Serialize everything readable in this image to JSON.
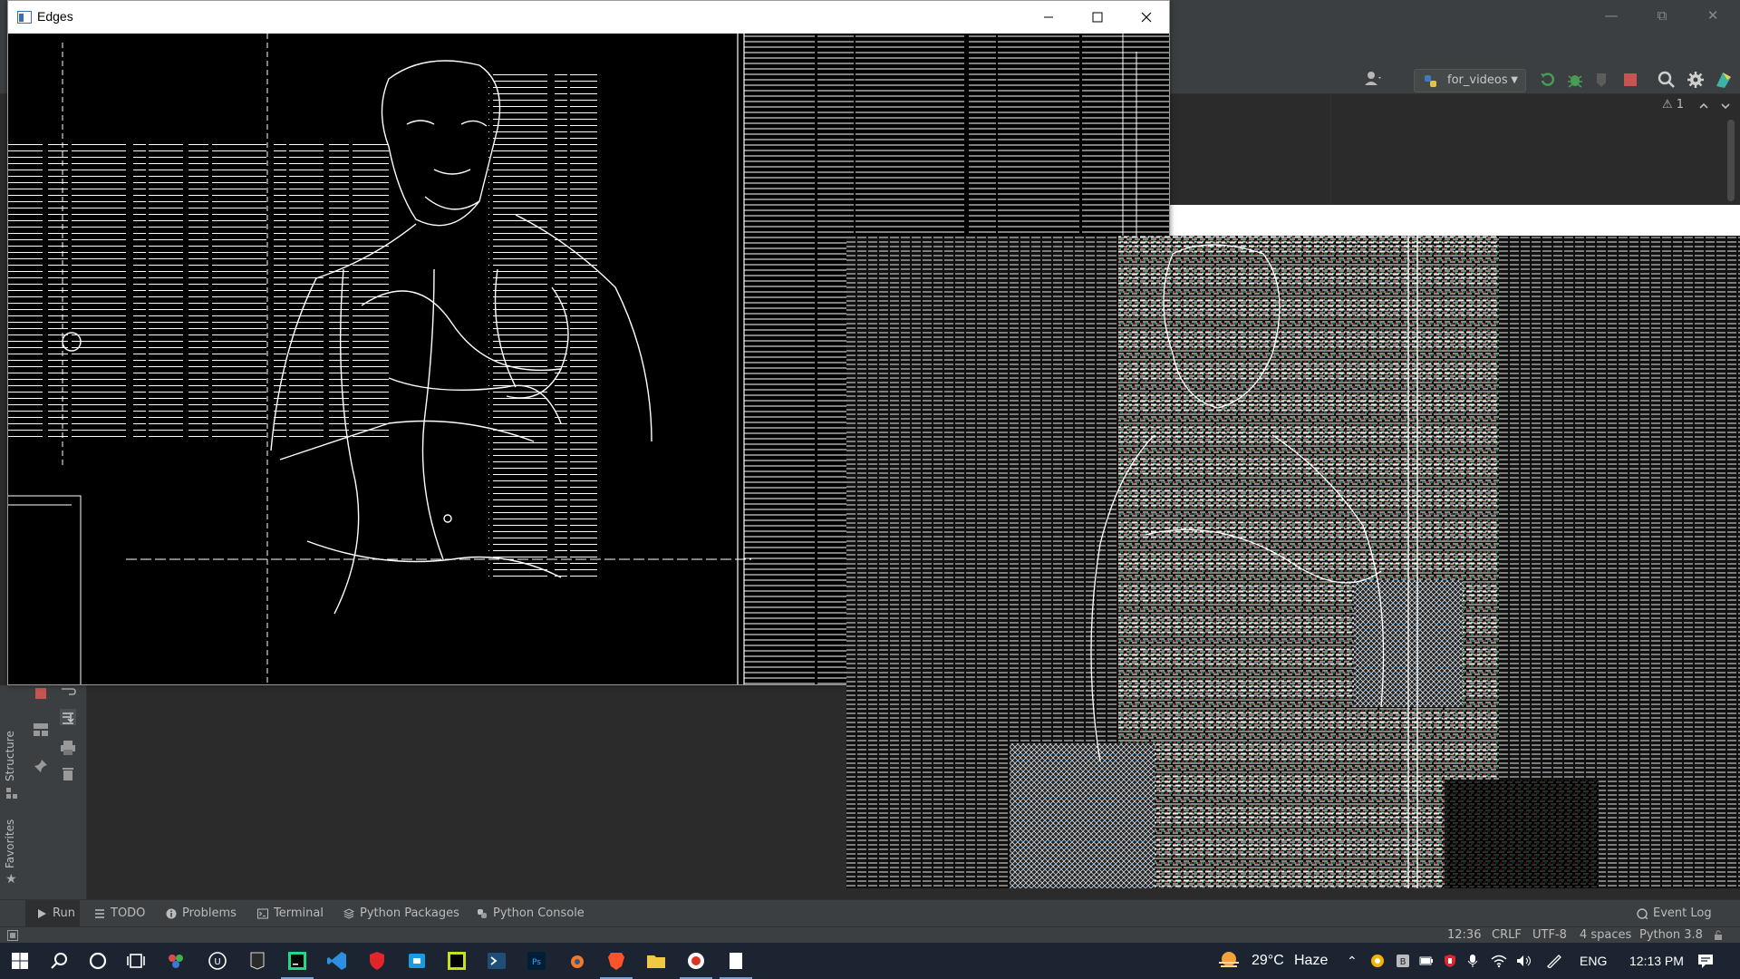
{
  "edges_window": {
    "title": "Edges"
  },
  "ide": {
    "run_config": "for_videos",
    "warning_count": "1"
  },
  "left_strip": {
    "structure_label": "Structure",
    "favorites_label": "Favorites"
  },
  "bottom_tabs": [
    {
      "label": "Run",
      "icon": "play-icon"
    },
    {
      "label": "TODO",
      "icon": "list-icon"
    },
    {
      "label": "Problems",
      "icon": "info-icon"
    },
    {
      "label": "Terminal",
      "icon": "terminal-icon"
    },
    {
      "label": "Python Packages",
      "icon": "layers-icon"
    },
    {
      "label": "Python Console",
      "icon": "python-icon"
    }
  ],
  "event_log": "Event Log",
  "status": {
    "position": "12:36",
    "line_sep": "CRLF",
    "encoding": "UTF-8",
    "indent": "4 spaces",
    "interpreter": "Python 3.8"
  },
  "taskbar": {
    "weather_temp": "29°C",
    "weather_text": "Haze",
    "language": "ENG",
    "time": "12:13 PM"
  },
  "colors": {
    "ide_bg": "#2b2b2b",
    "ide_panel": "#3c3f41",
    "taskbar_bg": "#1b2430",
    "stop_red": "#c75450",
    "run_green": "#499c54"
  }
}
